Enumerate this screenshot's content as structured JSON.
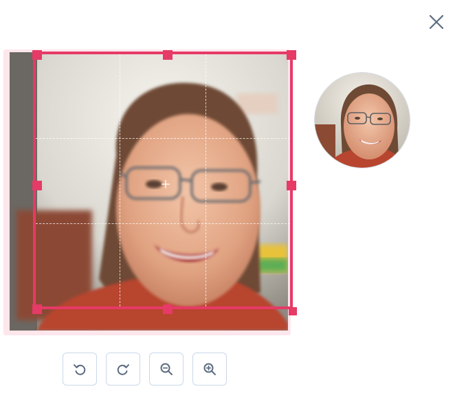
{
  "dialog": {
    "close_label": "×"
  },
  "toolbar": {
    "buttons": [
      {
        "id": "rotate-left",
        "icon": "rotate-left-icon"
      },
      {
        "id": "rotate-right",
        "icon": "rotate-right-icon"
      },
      {
        "id": "zoom-out",
        "icon": "zoom-out-icon"
      },
      {
        "id": "zoom-in",
        "icon": "zoom-in-icon"
      }
    ]
  },
  "colors": {
    "accent": "#e63a67",
    "icon": "#5b6b80",
    "button_border": "#c9d8ea"
  }
}
